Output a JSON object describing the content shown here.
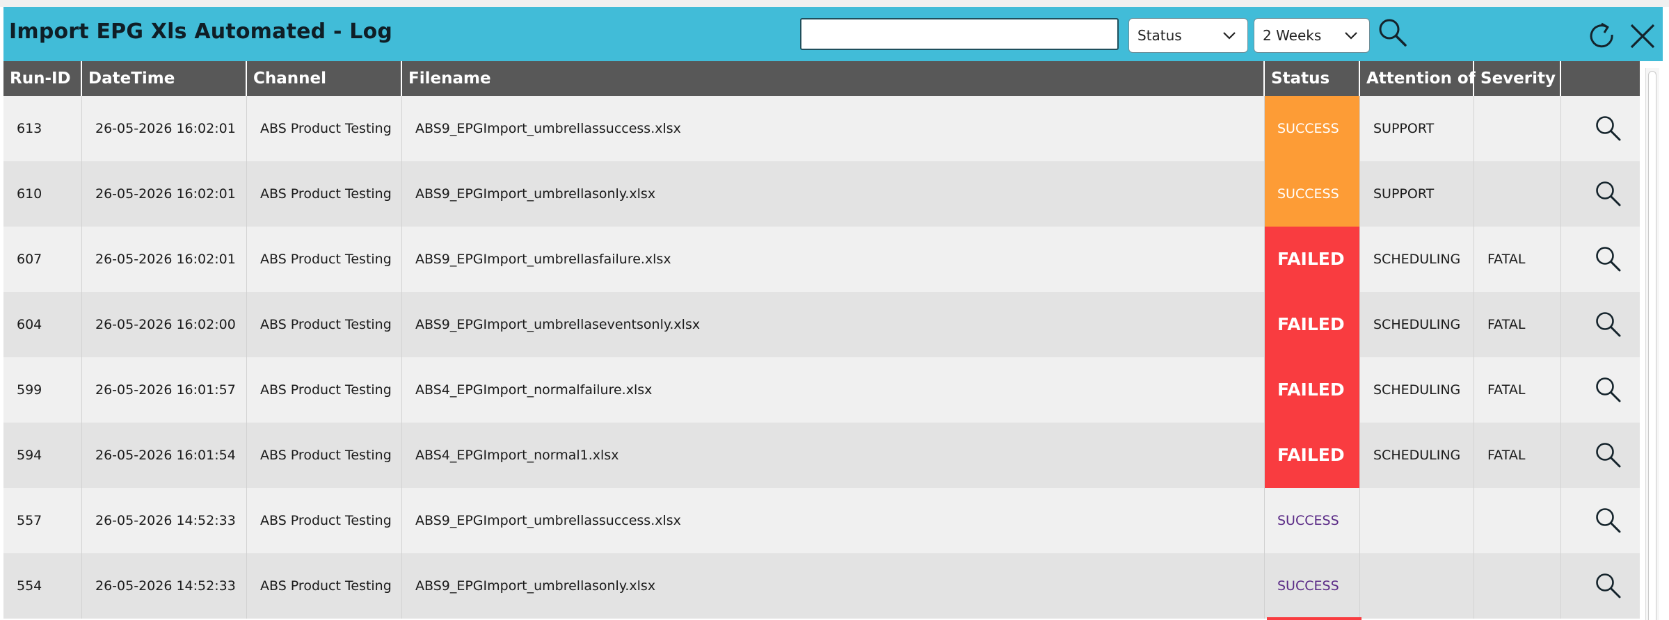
{
  "window": {
    "title": "Import EPG Xls Automated - Log"
  },
  "toolbar": {
    "search_value": "",
    "status_filter": "Status",
    "period_filter": "2 Weeks",
    "search_icon": "search-icon",
    "refresh_icon": "refresh-icon",
    "close_icon": "close-icon"
  },
  "colors": {
    "titlebar": "#41bcd8",
    "header": "#585858",
    "success_badge": "#fd9c36",
    "failed_badge": "#f93c40",
    "success_text": "#5a2a86"
  },
  "table": {
    "columns": [
      "Run-ID",
      "DateTime",
      "Channel",
      "Filename",
      "Status",
      "Attention of",
      "Severity",
      ""
    ],
    "rows": [
      {
        "run_id": "613",
        "datetime": "26-05-2026 16:02:01",
        "channel": "ABS Product Testing",
        "filename": "ABS9_EPGImport_umbrellassuccess.xlsx",
        "status": "SUCCESS",
        "attention": "SUPPORT",
        "severity": ""
      },
      {
        "run_id": "610",
        "datetime": "26-05-2026 16:02:01",
        "channel": "ABS Product Testing",
        "filename": "ABS9_EPGImport_umbrellasonly.xlsx",
        "status": "SUCCESS",
        "attention": "SUPPORT",
        "severity": ""
      },
      {
        "run_id": "607",
        "datetime": "26-05-2026 16:02:01",
        "channel": "ABS Product Testing",
        "filename": "ABS9_EPGImport_umbrellasfailure.xlsx",
        "status": "FAILED",
        "attention": "SCHEDULING",
        "severity": "FATAL"
      },
      {
        "run_id": "604",
        "datetime": "26-05-2026 16:02:00",
        "channel": "ABS Product Testing",
        "filename": "ABS9_EPGImport_umbrellaseventsonly.xlsx",
        "status": "FAILED",
        "attention": "SCHEDULING",
        "severity": "FATAL"
      },
      {
        "run_id": "599",
        "datetime": "26-05-2026 16:01:57",
        "channel": "ABS Product Testing",
        "filename": "ABS4_EPGImport_normalfailure.xlsx",
        "status": "FAILED",
        "attention": "SCHEDULING",
        "severity": "FATAL"
      },
      {
        "run_id": "594",
        "datetime": "26-05-2026 16:01:54",
        "channel": "ABS Product Testing",
        "filename": "ABS4_EPGImport_normal1.xlsx",
        "status": "FAILED",
        "attention": "SCHEDULING",
        "severity": "FATAL"
      },
      {
        "run_id": "557",
        "datetime": "26-05-2026 14:52:33",
        "channel": "ABS Product Testing",
        "filename": "ABS9_EPGImport_umbrellassuccess.xlsx",
        "status": "SUCCESS",
        "attention": "",
        "severity": ""
      },
      {
        "run_id": "554",
        "datetime": "26-05-2026 14:52:33",
        "channel": "ABS Product Testing",
        "filename": "ABS9_EPGImport_umbrellasonly.xlsx",
        "status": "SUCCESS",
        "attention": "",
        "severity": ""
      }
    ]
  }
}
